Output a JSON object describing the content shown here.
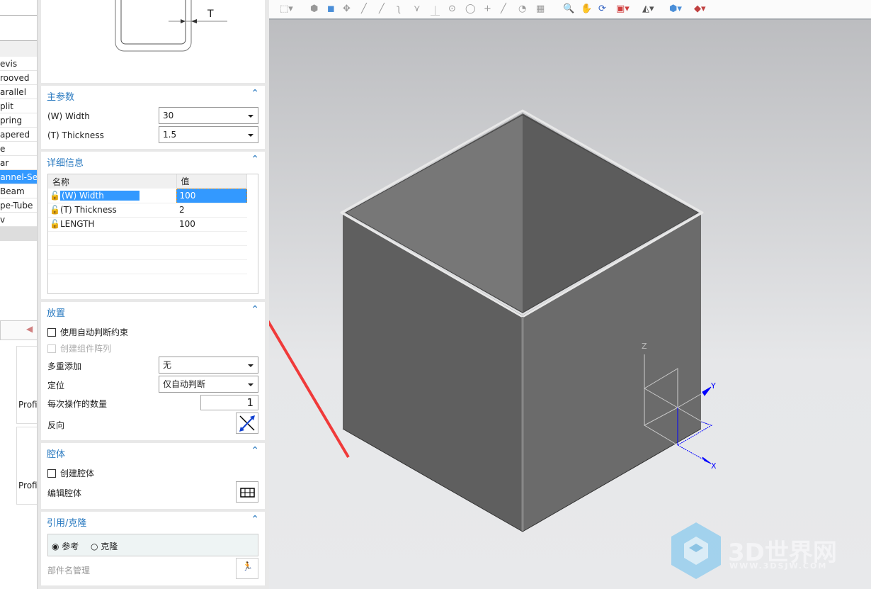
{
  "left_list": {
    "items": [
      "evis",
      "rooved",
      "arallel",
      "plit",
      "pring",
      "apered",
      "e",
      "ar",
      "hannel-Se",
      "Beam",
      "pe-Tube",
      "v"
    ],
    "selected_index": 8,
    "tiles": [
      "Profi",
      "Profi"
    ]
  },
  "diagram": {
    "dimension_label": "T"
  },
  "main_params": {
    "title": "主参数",
    "width_label": "(W) Width",
    "width_value": "30",
    "thickness_label": "(T) Thickness",
    "thickness_value": "1.5"
  },
  "details": {
    "title": "详细信息",
    "columns": [
      "名称",
      "值"
    ],
    "rows": [
      {
        "name": "(W) Width",
        "value": "100",
        "selected": true
      },
      {
        "name": "(T) Thickness",
        "value": "2"
      },
      {
        "name": "LENGTH",
        "value": "100"
      }
    ]
  },
  "placement": {
    "title": "放置",
    "auto_constraint": "使用自动判断约束",
    "create_array": "创建组件阵列",
    "multi_add_label": "多重添加",
    "multi_add_value": "无",
    "position_label": "定位",
    "position_value": "仅自动判断",
    "count_label": "每次操作的数量",
    "count_value": "1",
    "reverse_label": "反向"
  },
  "cavity": {
    "title": "腔体",
    "create": "创建腔体",
    "edit": "编辑腔体"
  },
  "reference": {
    "title": "引用/克隆",
    "option_ref": "参考",
    "option_clone": "克隆",
    "selected": "参考",
    "part_name_mgmt": "部件名管理"
  },
  "triad": {
    "x": "X",
    "y": "Y",
    "z": "Z"
  },
  "watermark": {
    "name": "3D世界网",
    "url": "WWW.3DSJW.COM"
  },
  "colors": {
    "accent": "#2a7ac0",
    "selection": "#3399ff",
    "annotation_arrow": "#f03a3a",
    "axis": "#0000ff"
  }
}
